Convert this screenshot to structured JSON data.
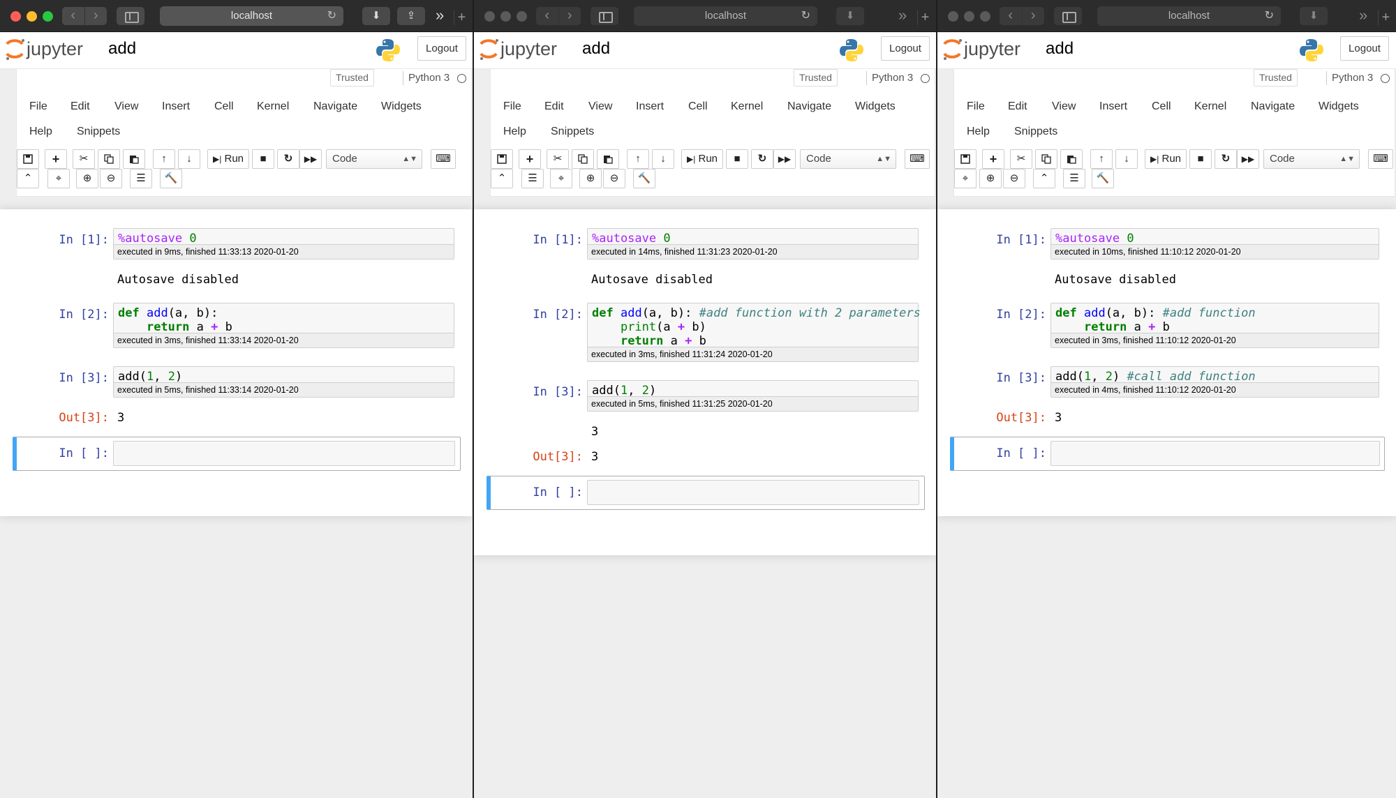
{
  "browser": {
    "url": "localhost"
  },
  "jupyter": {
    "logo_text": "jupyter",
    "notebook_title": "add",
    "logout_label": "Logout",
    "trusted_label": "Trusted",
    "kernel_name": "Python 3",
    "menu": [
      "File",
      "Edit",
      "View",
      "Insert",
      "Cell",
      "Kernel",
      "Navigate",
      "Widgets",
      "Help",
      "Snippets"
    ],
    "run_label": "Run",
    "cell_type": "Code"
  },
  "windows": [
    {
      "cells": [
        {
          "prompt": "In [1]:",
          "exec": "executed in 9ms, finished 11:33:13 2020-01-20",
          "output": "Autosave disabled"
        },
        {
          "prompt": "In [2]:",
          "exec": "executed in 3ms, finished 11:33:14 2020-01-20"
        },
        {
          "prompt": "In [3]:",
          "exec": "executed in 5ms, finished 11:33:14 2020-01-20",
          "out_prompt": "Out[3]:",
          "output": "3"
        },
        {
          "prompt": "In [ ]:"
        }
      ]
    },
    {
      "cells": [
        {
          "prompt": "In [1]:",
          "exec": "executed in 14ms, finished 11:31:23 2020-01-20",
          "output": "Autosave disabled"
        },
        {
          "prompt": "In [2]:",
          "exec": "executed in 3ms, finished 11:31:24 2020-01-20"
        },
        {
          "prompt": "In [3]:",
          "exec": "executed in 5ms, finished 11:31:25 2020-01-20",
          "stdout": "3",
          "out_prompt": "Out[3]:",
          "output": "3"
        },
        {
          "prompt": "In [ ]:"
        }
      ]
    },
    {
      "cells": [
        {
          "prompt": "In [1]:",
          "exec": "executed in 10ms, finished 11:10:12 2020-01-20",
          "output": "Autosave disabled"
        },
        {
          "prompt": "In [2]:",
          "exec": "executed in 3ms, finished 11:10:12 2020-01-20"
        },
        {
          "prompt": "In [3]:",
          "exec": "executed in 4ms, finished 11:10:12 2020-01-20",
          "out_prompt": "Out[3]:",
          "output": "3"
        },
        {
          "prompt": "In [ ]:"
        }
      ]
    }
  ],
  "code": {
    "autosave": {
      "magic": "%autosave",
      "arg": "0"
    },
    "def_kw": "def",
    "fn_name": "add",
    "params": "(a, b):",
    "return_kw": "return",
    "ret_a": "a",
    "plus": "+",
    "ret_b": "b",
    "print_fn": "print",
    "print_args_open": "(a",
    "print_args_close": "b)",
    "comment_2": "#add function with 2 parameters",
    "comment_3": "#add function",
    "call_open": "add(",
    "call_one": "1",
    "call_sep": ", ",
    "call_two": "2",
    "call_close": ")",
    "comment_call": "#call add function"
  }
}
